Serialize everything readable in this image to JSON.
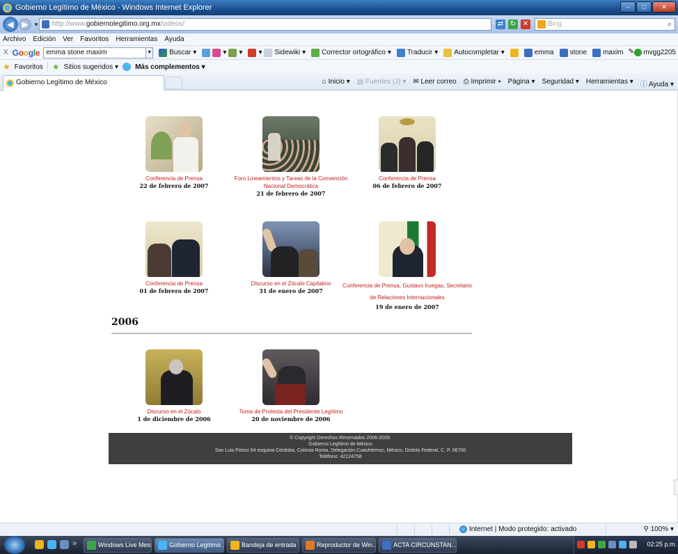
{
  "window": {
    "title": "Gobierno Legítimo de México - Windows Internet Explorer"
  },
  "address_bar": {
    "url_prefix": "http://www.",
    "url_host": "gobiernolegitimo.org.mx",
    "url_path": "/videos/",
    "search_placeholder": "Bing"
  },
  "menu": {
    "items": [
      "Archivo",
      "Edición",
      "Ver",
      "Favoritos",
      "Herramientas",
      "Ayuda"
    ]
  },
  "google_toolbar": {
    "close": "X",
    "logo": [
      "G",
      "o",
      "o",
      "g",
      "l",
      "e"
    ],
    "search_value": "emma stone maxim",
    "buscar": "Buscar",
    "sidewiki": "Sidewiki",
    "corrector": "Corrector ortográfico",
    "traducir": "Traducir",
    "autocompletar": "Autocompletar",
    "term1": "emma",
    "term2": "stone",
    "term3": "maxim",
    "user": "mvgg2205"
  },
  "favorites_bar": {
    "favoritos": "Favoritos",
    "sitios": "Sitios sugeridos",
    "complementos": "Más complementos"
  },
  "tabs": {
    "active_tab": "Gobierno Legítimo de México"
  },
  "command_bar": {
    "inicio": "Inicio",
    "fuentes": "Fuentes (J)",
    "leer_correo": "Leer correo",
    "imprimir": "Imprimir",
    "pagina": "Página",
    "seguridad": "Seguridad",
    "herramientas": "Herramientas",
    "ayuda": "Ayuda"
  },
  "videos": [
    {
      "caption": "Conferencia de Prensa",
      "date": "22 de febrero de 2007"
    },
    {
      "caption": "Foro Lineamientos y Tareas de la Convención Nacional Democrática",
      "date": "21 de febrero de 2007"
    },
    {
      "caption": "Conferencia de Prensa",
      "date": "06 de febrero de 2007"
    },
    {
      "caption": "Conferencia de Prensa",
      "date": "01 de febrero de 2007"
    },
    {
      "caption": "Discurso en el Zócalo Capitalino",
      "date": "31 de enero de 2007"
    },
    {
      "caption": "Conferencia de Prensa, Gustavo Iruegas, Secretario de Relaciones Internacionales",
      "date": "19 de enero de 2007"
    }
  ],
  "section_2006": {
    "heading": "2006",
    "videos": [
      {
        "caption": "Discurso en el Zócalo",
        "date": "1 de diciembre de 2006"
      },
      {
        "caption": "Toma de Protesta del Presidente Legítimo",
        "date": "20 de noviembre de 2006"
      }
    ]
  },
  "footer": {
    "line1": "© Copyright Derechos Reservados 2006-2009.",
    "line2": "Gobierno Legítimo de México",
    "line3": "San Luis Potosí 64 esquina Córdoba, Colonia Roma, Delegación Cuauhtémoc, México, Distrito Federal, C. P. 06700",
    "line4": "Teléfono: 42124758"
  },
  "status_bar": {
    "zone": "Internet | Modo protegido: activado",
    "zoom": "100%"
  },
  "taskbar": {
    "tasks": [
      "Windows Live Mess...",
      "Gobierno Legítimo ...",
      "Bandeja de entrada ...",
      "Reproductor de Win...",
      "ACTA CIRCUNSTAN..."
    ],
    "clock": "02:25 p.m."
  }
}
